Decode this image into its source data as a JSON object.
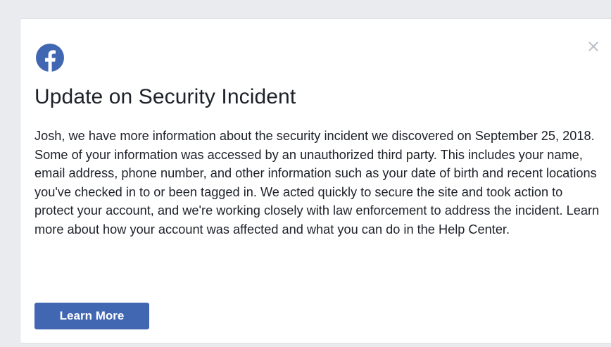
{
  "dialog": {
    "logo_icon": "facebook-logo-icon",
    "close_icon": "close-icon",
    "title": "Update on Security Incident",
    "body": "Josh, we have more information about the security incident we discovered on September 25, 2018. Some of your information was accessed by an unauthorized third party. This includes your name, email address, phone number, and other information such as your date of birth and recent locations you've checked in to or been tagged in. We acted quickly to secure the site and took action to protect your account, and we're working closely with law enforcement to address the incident. Learn more about how your account was affected and what you can do in the Help Center.",
    "button_label": "Learn More"
  },
  "colors": {
    "brand": "#4267b2",
    "background": "#e9ebee",
    "text": "#1d2129",
    "close": "#bec3c9"
  }
}
